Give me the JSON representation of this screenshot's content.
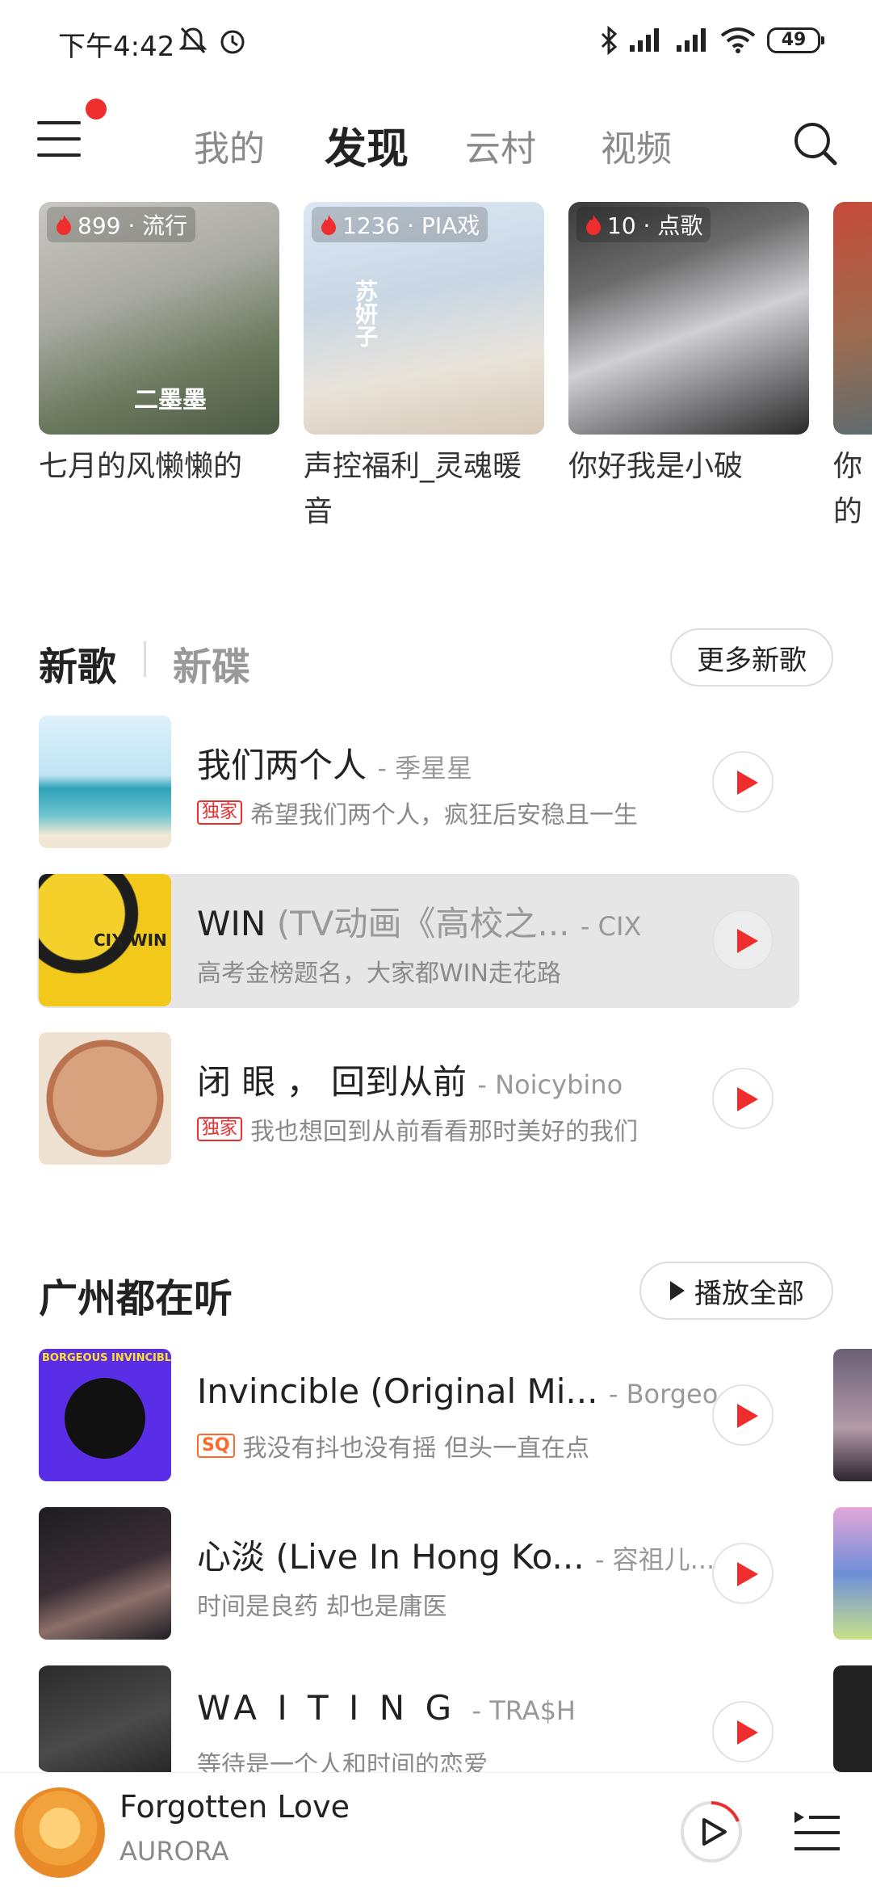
{
  "status_bar": {
    "time": "下午4:42",
    "battery": "49",
    "icons": [
      "mute-bell-icon",
      "alarm-icon",
      "bluetooth-icon",
      "signal-icon",
      "signal-icon",
      "wifi-icon",
      "battery-icon"
    ]
  },
  "nav": {
    "tabs": [
      {
        "label": "我的"
      },
      {
        "label": "发现"
      },
      {
        "label": "云村"
      },
      {
        "label": "视频"
      }
    ],
    "active_tab": "发现"
  },
  "podcasts": [
    {
      "count": "899 · 流行",
      "title": "七月的风懒懒的",
      "cover_text": "二墨墨"
    },
    {
      "count": "1236 · PIA戏",
      "title": "声控福利_灵魂暖音",
      "cover_text": "苏妍子"
    },
    {
      "count": "10 · 点歌",
      "title": "你好我是小破"
    },
    {
      "title": "你的线"
    }
  ],
  "new_songs": {
    "tab_active": "新歌",
    "tab_inactive": "新碟",
    "more_button": "更多新歌",
    "items": [
      {
        "title": "我们两个人",
        "title_extra": "",
        "artist": "- 季星星",
        "tag": "独家",
        "desc": "希望我们两个人，疯狂后安稳且一生"
      },
      {
        "title": "WIN",
        "title_extra": "(TV动画《高校之...",
        "artist": "- CIX",
        "tag": "",
        "desc": "高考金榜题名，大家都WIN走花路",
        "cover_text": "CIX WIN"
      },
      {
        "title": "闭 眼 ， 回到从前",
        "title_extra": "",
        "artist": "- Noicybino",
        "tag": "独家",
        "desc": "我也想回到从前看看那时美好的我们"
      }
    ]
  },
  "guangzhou": {
    "title": "广州都在听",
    "play_all": "播放全部",
    "items": [
      {
        "title": "Invincible (Original Mi...",
        "artist": "- Borgeo...",
        "tag": "SQ",
        "desc": "我没有抖也没有摇 但头一直在点",
        "cover_text": "BORGEOUS INVINCIBLE"
      },
      {
        "title": "心淡 (Live In Hong Ko...",
        "artist": "- 容祖儿...",
        "tag": "",
        "desc": "时间是良药 却也是庸医"
      },
      {
        "title": "WA I T I N G",
        "artist": "- TRA$H",
        "tag": "",
        "desc": "等待是一个人和时间的恋爱"
      }
    ]
  },
  "player": {
    "title": "Forgotten Love",
    "artist": "AURORA"
  },
  "colors": {
    "accent": "#ef2d2d",
    "text_primary": "#222222",
    "text_secondary": "#8a8a8a",
    "highlight_row": "#e6e6e6"
  }
}
